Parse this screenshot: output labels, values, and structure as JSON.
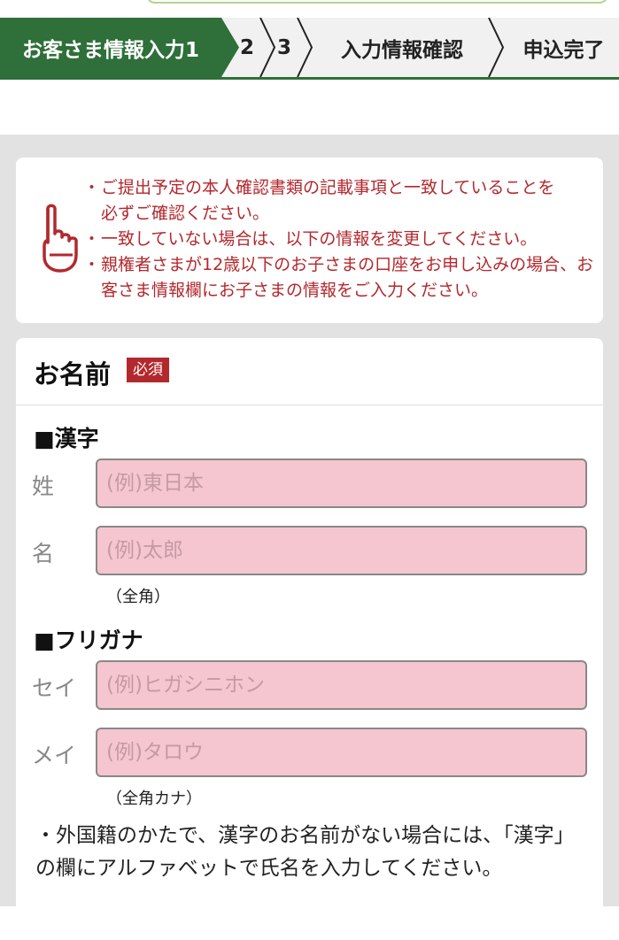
{
  "steps": [
    {
      "label": "お客さま情報入力1",
      "active": true
    },
    {
      "label": "2",
      "active": false
    },
    {
      "label": "3",
      "active": false
    },
    {
      "label": "入力情報確認",
      "active": false
    },
    {
      "label": "申込完了",
      "active": false
    }
  ],
  "notice": {
    "icon": "pointing-hand-icon",
    "color": "#b3282d",
    "items": [
      "ご提出予定の本人確認書類の記載事項と一致していることを必ずご確認ください。",
      "一致していない場合は、以下の情報を変更してください。",
      "親権者さまが12歳以下のお子さまの口座をお申し込みの場合、お客さま情報欄にお子さまの情報をご入力ください。"
    ]
  },
  "name_section": {
    "title": "お名前",
    "required_badge": "必須",
    "kanji": {
      "heading": "■漢字",
      "sei_label": "姓",
      "sei_placeholder": "(例)東日本",
      "mei_label": "名",
      "mei_placeholder": "(例)太郎",
      "hint": "（全角）"
    },
    "furigana": {
      "heading": "■フリガナ",
      "sei_label": "セイ",
      "sei_placeholder": "(例)ヒガシニホン",
      "mei_label": "メイ",
      "mei_placeholder": "(例)タロウ",
      "hint": "（全角カナ）"
    },
    "footnote": "・外国籍のかたで、漢字のお名前がない場合には、「漢字」の欄にアルファベットで氏名を入力してください。"
  },
  "colors": {
    "brand_green": "#2f6f3a",
    "accent_red": "#b3282d",
    "field_pink": "#f5c6cf"
  }
}
